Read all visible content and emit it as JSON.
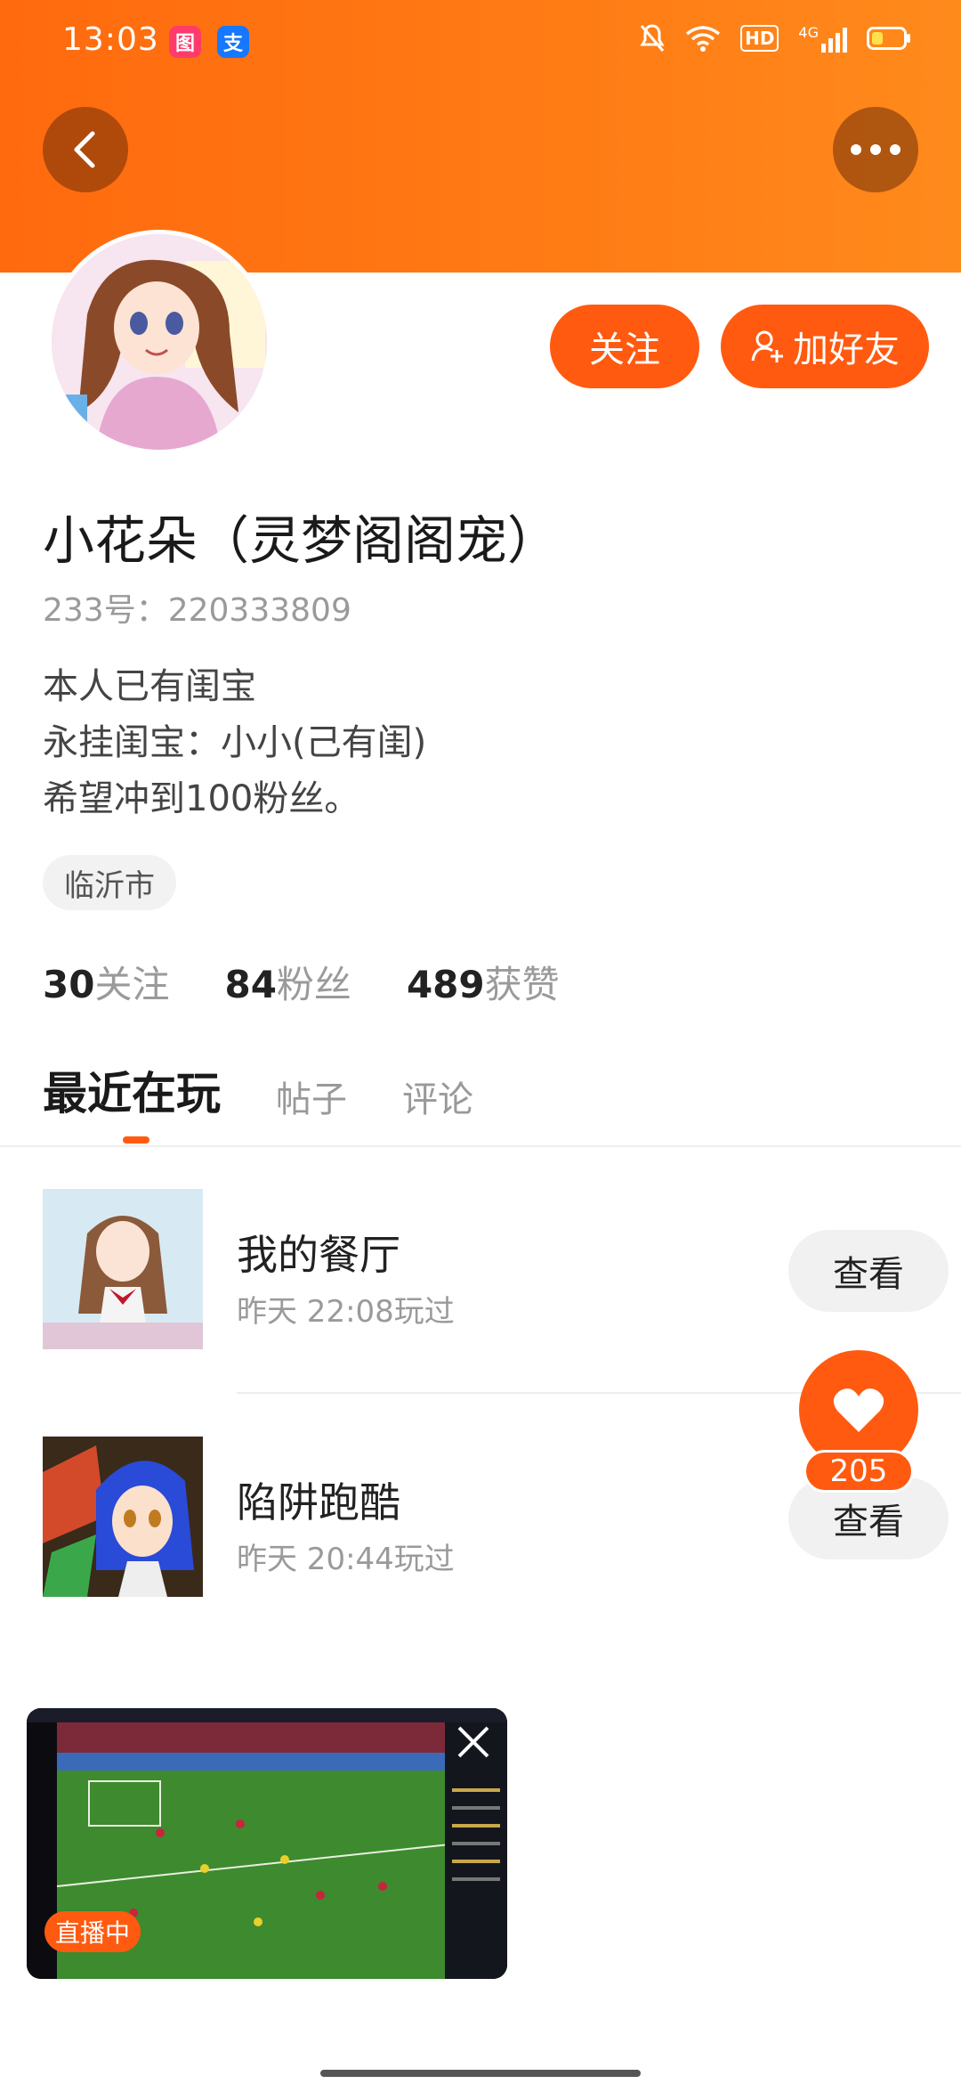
{
  "status_bar": {
    "time": "13:03",
    "badge_a": "图",
    "badge_b": "支",
    "hd": "HD",
    "network": "4G"
  },
  "profile": {
    "nickname": "小花朵（灵梦阁阁宠）",
    "uid": "233号：220333809",
    "bio": [
      "本人已有闺宝",
      "永挂闺宝：小小(己有闺)",
      "希望冲到100粉丝。"
    ],
    "location": "临沂市"
  },
  "actions": {
    "follow": "关注",
    "add_friend": "加好友"
  },
  "stats": [
    {
      "num": "30",
      "label": "关注"
    },
    {
      "num": "84",
      "label": "粉丝"
    },
    {
      "num": "489",
      "label": "获赞"
    }
  ],
  "tabs": [
    "最近在玩",
    "帖子",
    "评论"
  ],
  "games": [
    {
      "title": "我的餐厅",
      "time": "昨天 22:08玩过",
      "button": "查看"
    },
    {
      "title": "陷阱跑酷",
      "time": "昨天 20:44玩过",
      "button": "查看"
    }
  ],
  "like": {
    "count": "205"
  },
  "mini_player": {
    "live_label": "直播中"
  },
  "colors": {
    "accent": "#ff5a10",
    "header": "#ff7a14"
  }
}
